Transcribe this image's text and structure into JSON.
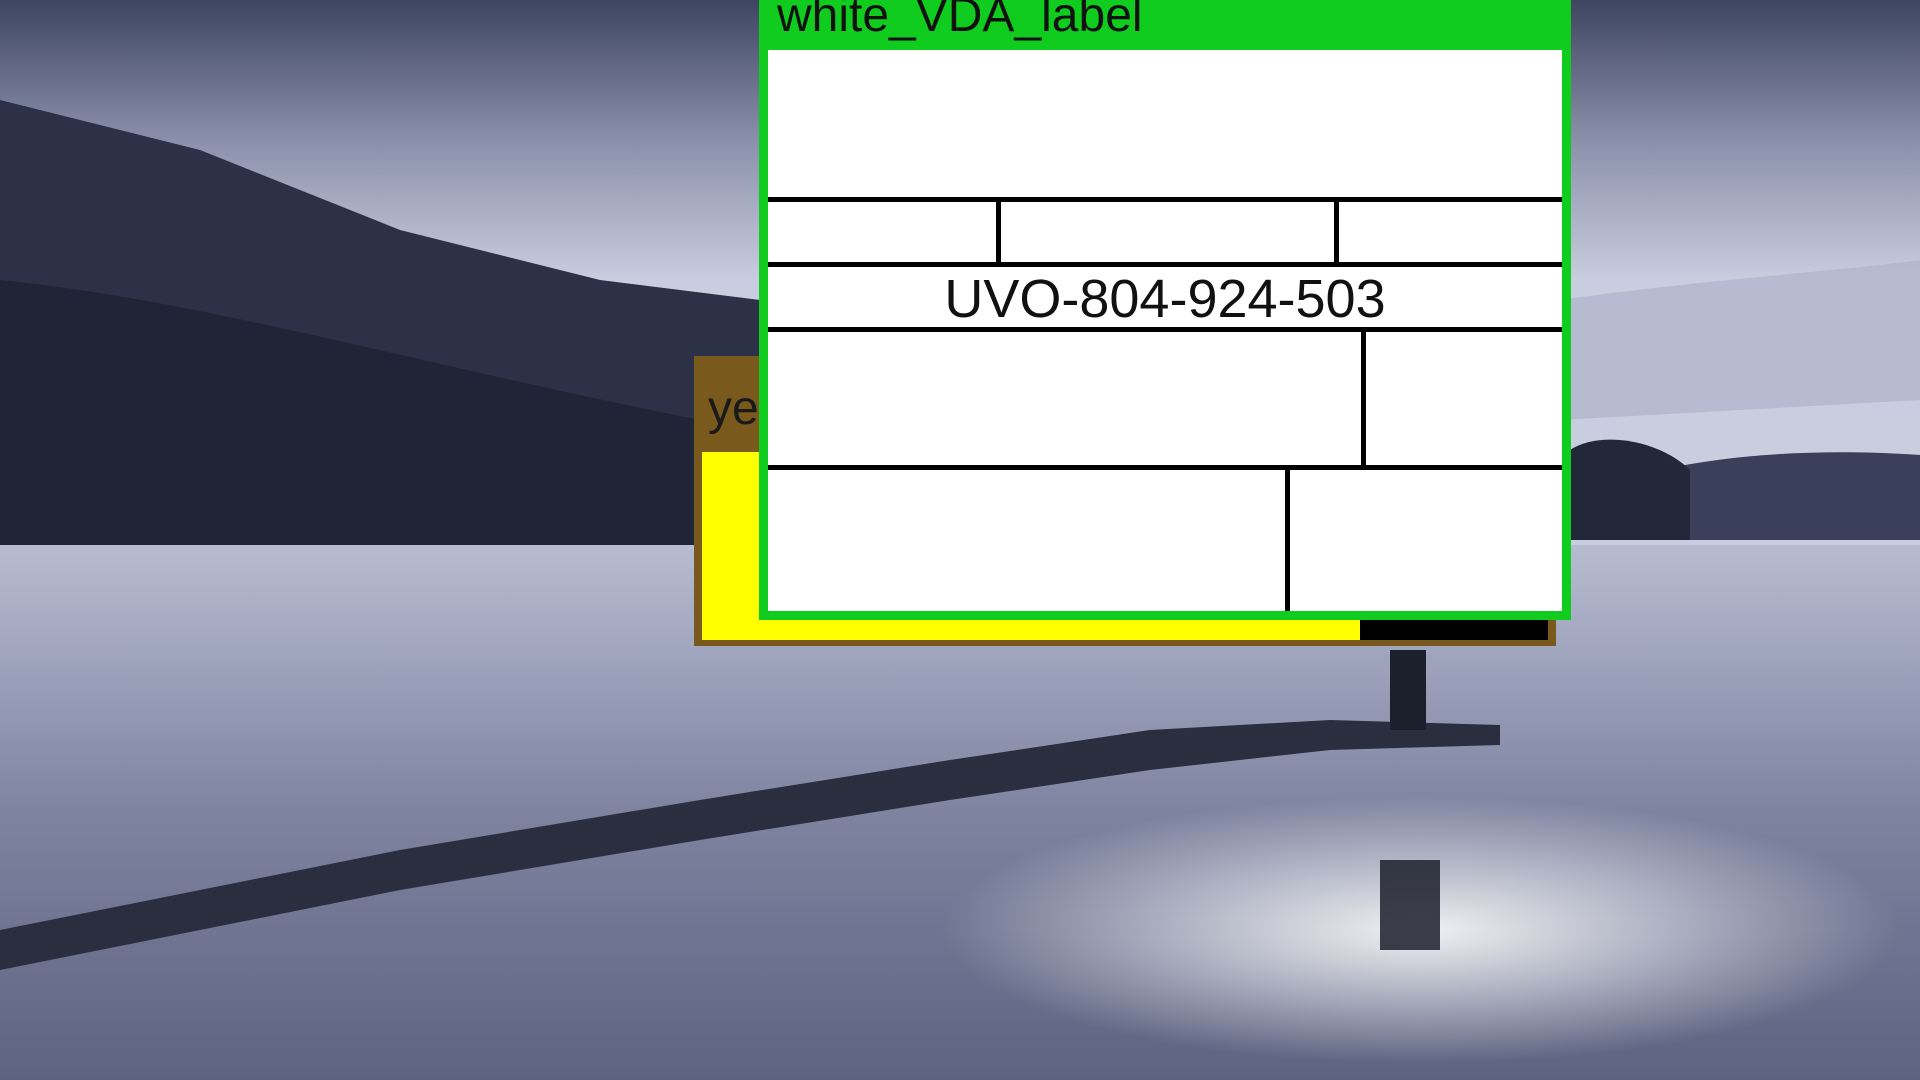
{
  "windows": {
    "yellow": {
      "title": "yellow_label"
    },
    "white_vda": {
      "title": "white_VDA_label",
      "code": "UVO-804-924-503"
    }
  },
  "colors": {
    "green_frame": "#0fcc1e",
    "yellow_frame": "#7a5a1c",
    "yellow_client": "#ffff00",
    "label_bg": "#ffffff"
  }
}
